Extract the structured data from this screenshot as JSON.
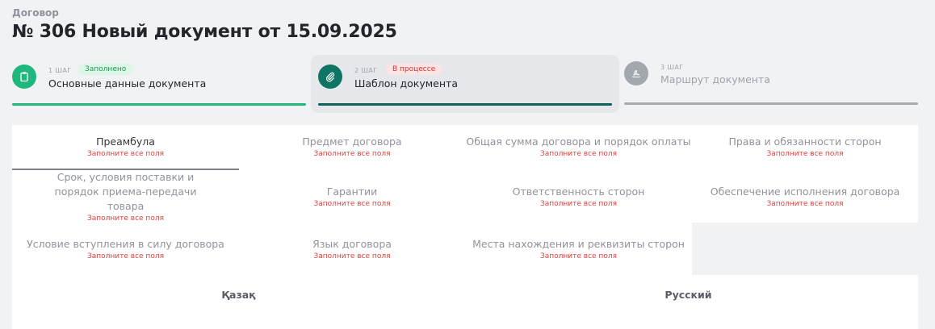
{
  "header": {
    "kind": "Договор",
    "title": "№ 306 Новый документ от 15.09.2025"
  },
  "steps": [
    {
      "num": "1 ШАГ",
      "badge": "Заполнено",
      "label": "Основные данные документа"
    },
    {
      "num": "2 ШАГ",
      "badge": "В процессе",
      "label": "Шаблон документа"
    },
    {
      "num": "3 ШАГ",
      "label": "Маршрут документа"
    }
  ],
  "sections": [
    {
      "title": "Преамбула",
      "sub": "Заполните все поля"
    },
    {
      "title": "Предмет договора",
      "sub": "Заполните все поля"
    },
    {
      "title": "Общая сумма договора и порядок оплаты",
      "sub": "Заполните все поля"
    },
    {
      "title": "Права и обязанности сторон",
      "sub": "Заполните все поля"
    },
    {
      "title": "Срок, условия поставки и порядок приема-передачи товара",
      "sub": "Заполните все поля"
    },
    {
      "title": "Гарантии",
      "sub": "Заполните все поля"
    },
    {
      "title": "Ответственность сторон",
      "sub": "Заполните все поля"
    },
    {
      "title": "Обеспечение исполнения договора",
      "sub": "Заполните все поля"
    },
    {
      "title": "Условие вступления в силу договора",
      "sub": "Заполните все поля"
    },
    {
      "title": "Язык договора",
      "sub": "Заполните все поля"
    },
    {
      "title": "Места нахождения и реквизиты сторон",
      "sub": "Заполните все поля"
    }
  ],
  "languages": [
    "Қазақ",
    "Русский"
  ],
  "colors": {
    "step_done": "#1fb77e",
    "step_active": "#0e7463",
    "step_pending": "#a3a7ae",
    "warning_text": "#e0413d"
  },
  "icons": {
    "step1": "clipboard-icon",
    "step2": "paperclip-icon",
    "step3": "signature-icon"
  }
}
